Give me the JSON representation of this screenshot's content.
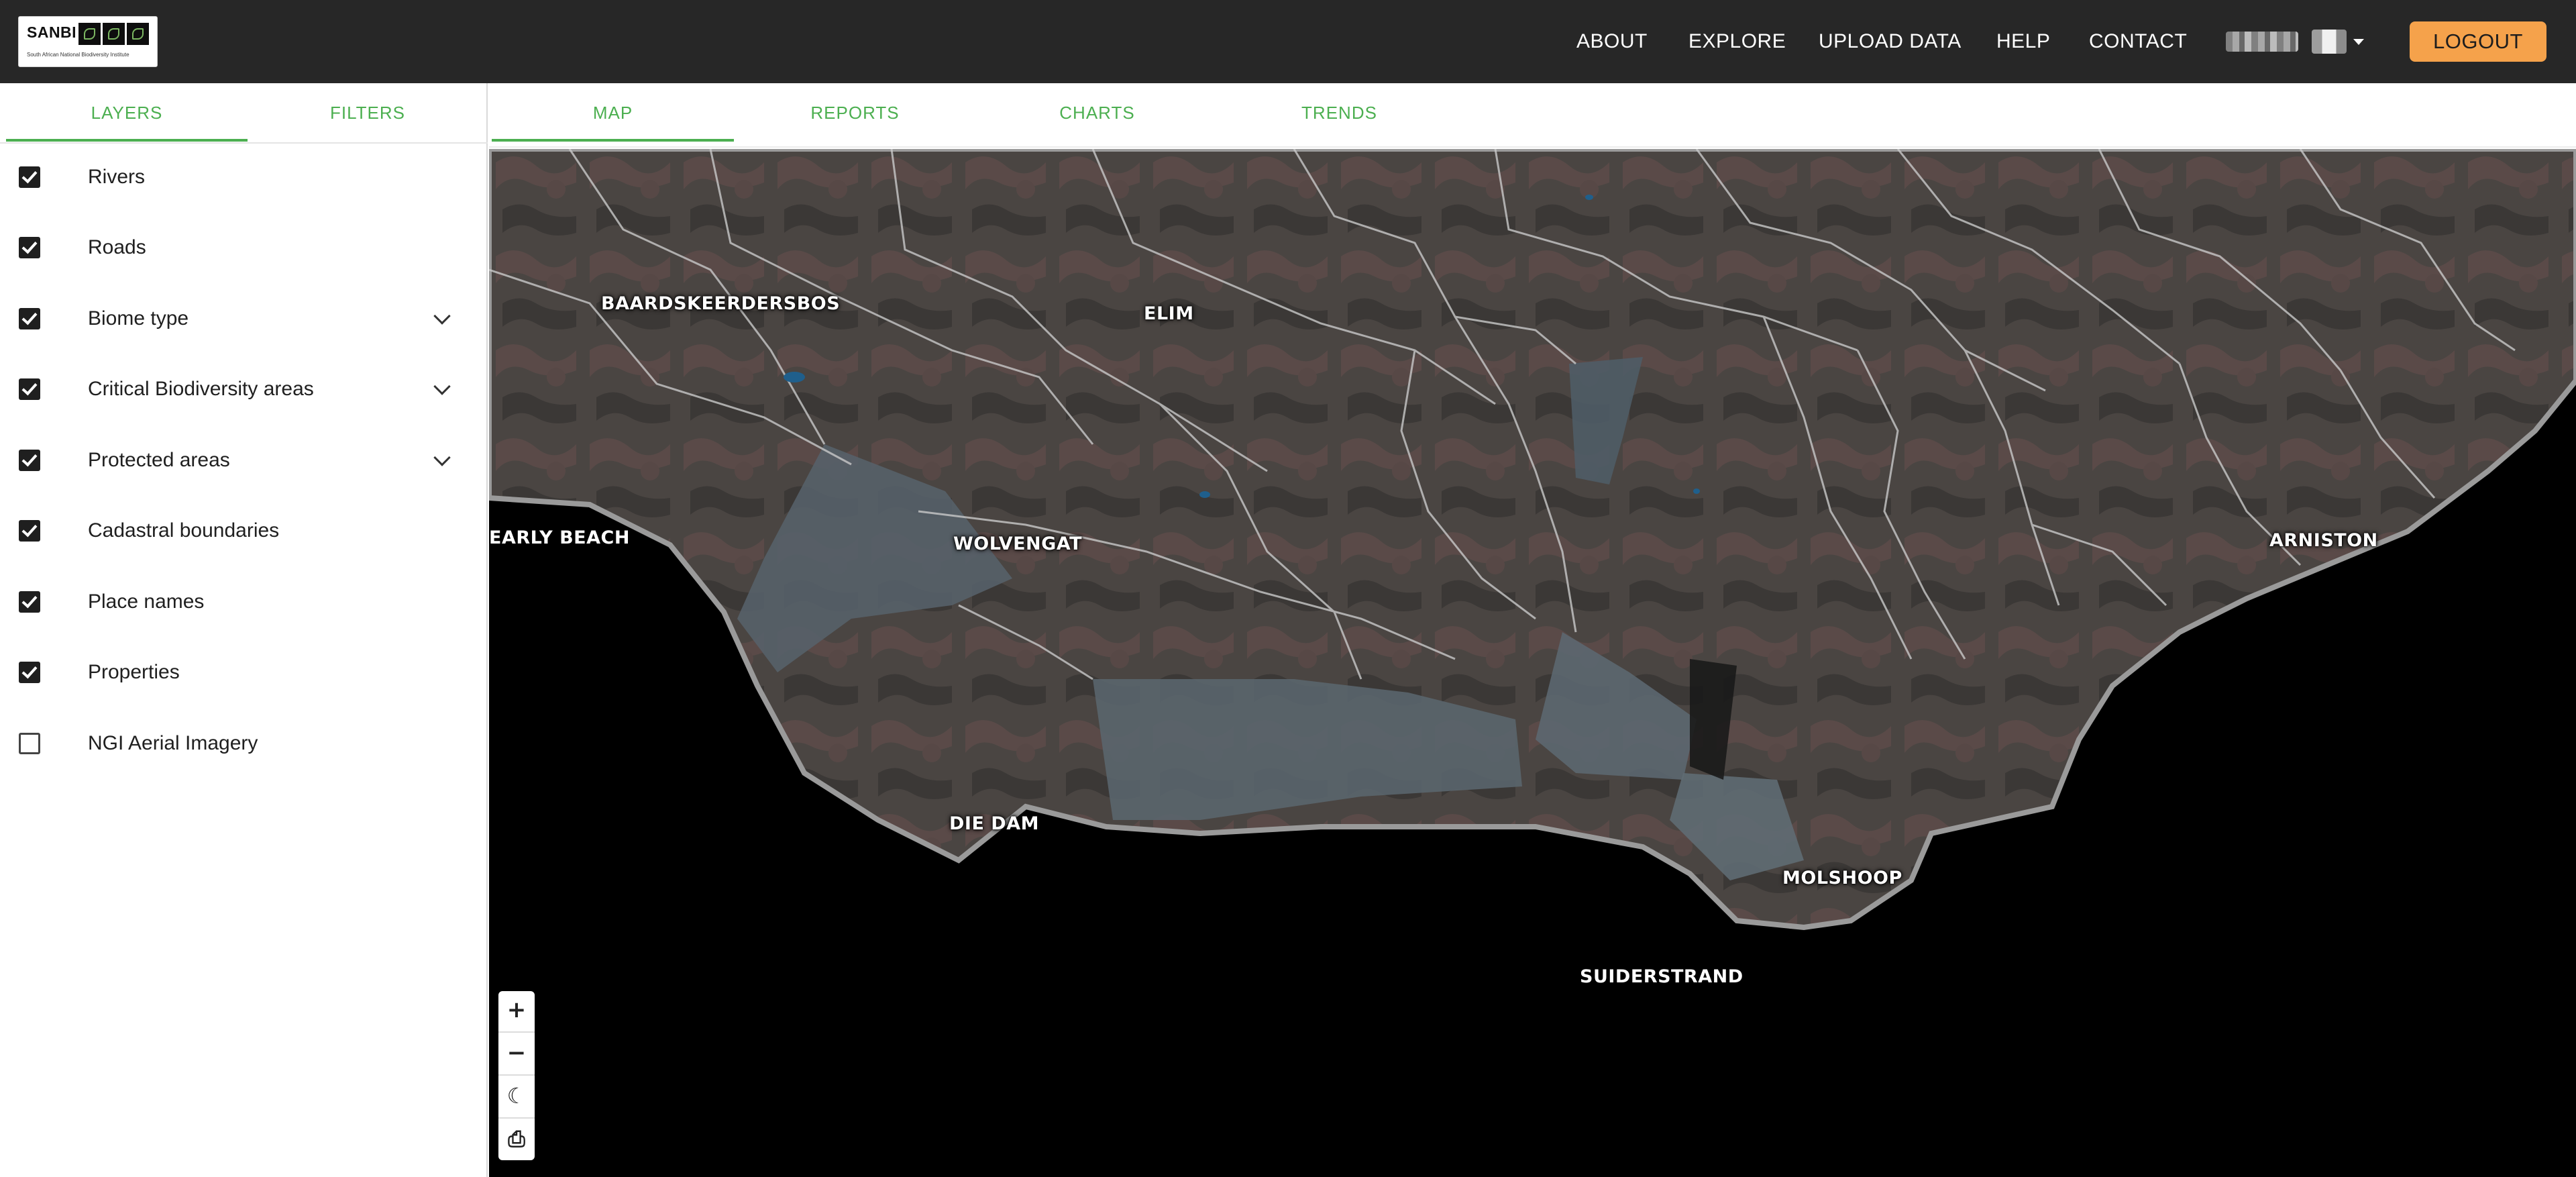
{
  "header": {
    "logo": {
      "text": "SANBI",
      "subtitle": "South African National Biodiversity Institute"
    },
    "nav": [
      "ABOUT",
      "EXPLORE",
      "UPLOAD DATA",
      "HELP",
      "CONTACT"
    ],
    "logout_label": "LOGOUT",
    "accent_color": "#f5a24b",
    "background_color": "#272727"
  },
  "sidebar": {
    "tabs": [
      {
        "label": "LAYERS",
        "active": true
      },
      {
        "label": "FILTERS",
        "active": false
      }
    ],
    "layers": [
      {
        "label": "Rivers",
        "checked": true,
        "expandable": false
      },
      {
        "label": "Roads",
        "checked": true,
        "expandable": false
      },
      {
        "label": "Biome type",
        "checked": true,
        "expandable": true
      },
      {
        "label": "Critical Biodiversity areas",
        "checked": true,
        "expandable": true
      },
      {
        "label": "Protected areas",
        "checked": true,
        "expandable": true
      },
      {
        "label": "Cadastral boundaries",
        "checked": true,
        "expandable": false
      },
      {
        "label": "Place names",
        "checked": true,
        "expandable": false
      },
      {
        "label": "Properties",
        "checked": true,
        "expandable": false
      },
      {
        "label": "NGI Aerial Imagery",
        "checked": false,
        "expandable": false
      }
    ]
  },
  "main": {
    "tabs": [
      {
        "label": "MAP",
        "active": true
      },
      {
        "label": "REPORTS",
        "active": false
      },
      {
        "label": "CHARTS",
        "active": false
      },
      {
        "label": "TRENDS",
        "active": false
      }
    ],
    "accent_color": "#4caf50"
  },
  "map": {
    "place_names": [
      "BAARDSKEERDERSBOS",
      "ELIM",
      "EARLY BEACH",
      "WOLVENGAT",
      "ARNISTON",
      "DIE DAM",
      "MOLSHOOP",
      "SUIDERSTRAND"
    ],
    "controls": [
      {
        "name": "zoom-in",
        "symbol": "+"
      },
      {
        "name": "zoom-out",
        "symbol": "−"
      },
      {
        "name": "dark-mode",
        "symbol": "☾"
      },
      {
        "name": "print",
        "symbol": "⎙"
      }
    ]
  }
}
